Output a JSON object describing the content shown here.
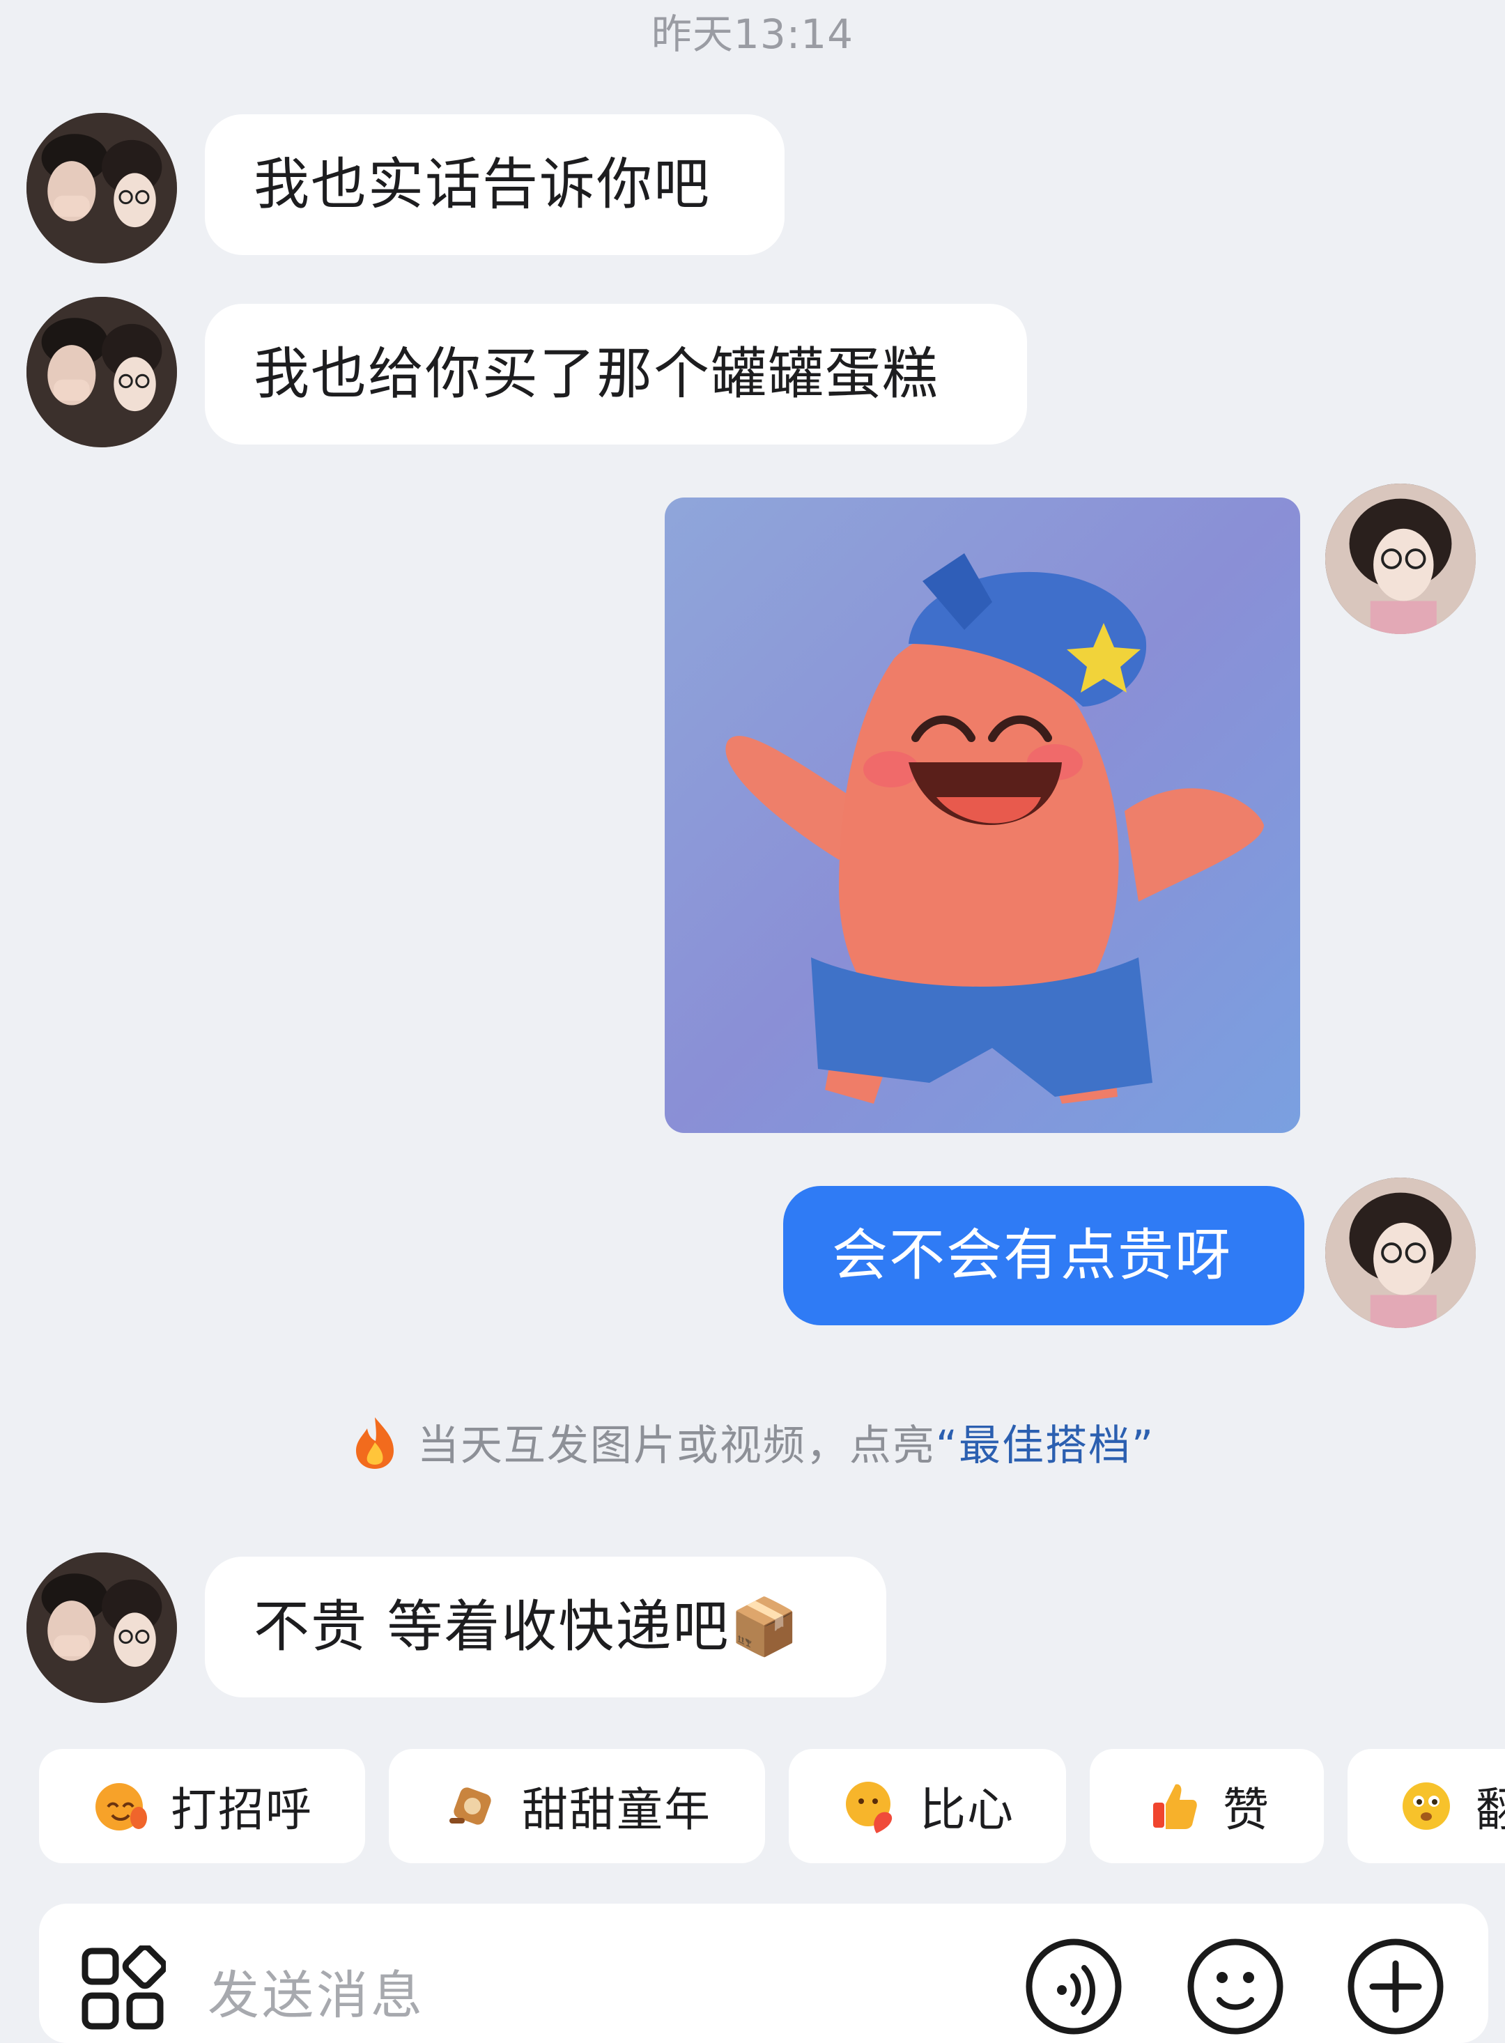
{
  "header": {
    "timestamp": "昨天13:14"
  },
  "messages": [
    {
      "sender": "other",
      "text": "我也实话告诉你吧"
    },
    {
      "sender": "other",
      "text": "我也给你买了那个罐罐蛋糕"
    },
    {
      "sender": "me",
      "type": "sticker",
      "sticker_icon": "patrick-star-sticker"
    },
    {
      "sender": "me",
      "text": "会不会有点贵呀"
    },
    {
      "sender": "other",
      "text": "不贵 等着收快递吧📦"
    }
  ],
  "notice": {
    "prefix": "当天互发图片或视频，点亮",
    "highlight": "“最佳搭档”",
    "icon": "fire-icon"
  },
  "quick_replies": [
    {
      "label": "打招呼",
      "icon": "wave-smile-emoji"
    },
    {
      "label": "甜甜童年",
      "icon": "candy-emoji"
    },
    {
      "label": "比心",
      "icon": "heart-hands-emoji"
    },
    {
      "label": "赞",
      "icon": "thumbs-up-emoji"
    },
    {
      "label": "翻",
      "icon": "thinking-emoji"
    }
  ],
  "composer": {
    "placeholder": "发送消息",
    "icons": [
      "apps-icon",
      "voice-icon",
      "emoji-icon",
      "plus-icon"
    ]
  },
  "colors": {
    "background": "#eef0f4",
    "bubble_other": "#ffffff",
    "bubble_mine": "#2f7bf5",
    "highlight_text": "#2b5fb0"
  }
}
